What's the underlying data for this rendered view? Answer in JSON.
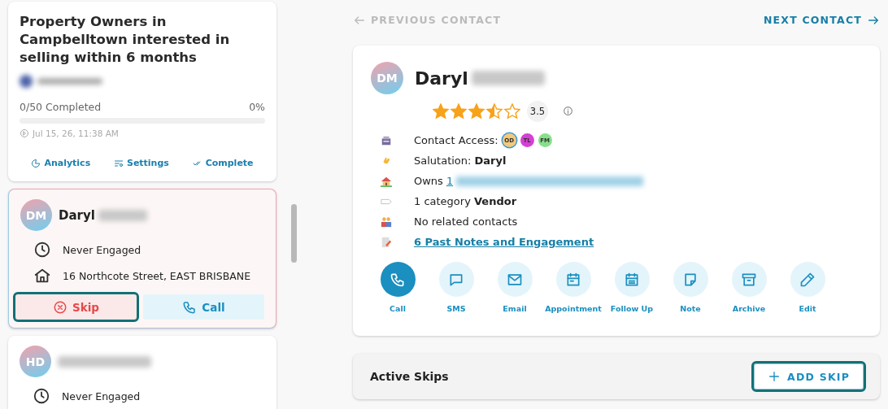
{
  "campaign": {
    "title": "Property Owners in Campbelltown interested in selling within 6 months",
    "progress_text": "0/50 Completed",
    "percent": "0%",
    "level": 0,
    "date": "Jul 15, 26, 11:38 AM",
    "actions": [
      {
        "kind": "analytics",
        "label": "Analytics"
      },
      {
        "kind": "settings",
        "label": "Settings"
      },
      {
        "kind": "complete",
        "label": "Complete"
      }
    ]
  },
  "contact_list": [
    {
      "initials": "DM",
      "name": "Daryl",
      "selected": true,
      "rows": [
        {
          "kind": "clock",
          "text": "Never Engaged"
        },
        {
          "kind": "home",
          "text": "16 Northcote Street, EAST BRISBANE"
        }
      ],
      "buttons": [
        {
          "kind": "skip",
          "label": "Skip",
          "highlighted": true
        },
        {
          "kind": "call",
          "label": "Call",
          "highlighted": false
        }
      ]
    },
    {
      "initials": "HD",
      "selected": false,
      "rows": [
        {
          "kind": "clock",
          "text": "Never Engaged"
        }
      ]
    }
  ],
  "nav": {
    "previous": "PREVIOUS CONTACT",
    "previous_disabled": true,
    "next": "NEXT CONTACT",
    "next_disabled": false
  },
  "contact": {
    "initials": "DM",
    "first_name": "Daryl",
    "stars": 3.5,
    "rating": "3.5",
    "details": [
      {
        "kind": "access",
        "text": "Contact Access:",
        "badges": [
          {
            "initials": "OD",
            "color": "#f3c97b"
          },
          {
            "initials": "TL",
            "color": "#d63fd6"
          },
          {
            "initials": "FM",
            "color": "#86e08a"
          }
        ]
      },
      {
        "kind": "wave",
        "text": "Salutation: **Daryl**"
      },
      {
        "kind": "house",
        "text": "Owns",
        "link": "1"
      },
      {
        "kind": "tag",
        "text": "1 category **Vendor**"
      },
      {
        "kind": "people",
        "text": "No related contacts"
      },
      {
        "kind": "note",
        "link": "6 Past Notes and Engagement"
      }
    ],
    "actions": [
      {
        "kind": "call",
        "label": "Call",
        "selected": true
      },
      {
        "kind": "sms",
        "label": "SMS",
        "selected": false
      },
      {
        "kind": "email",
        "label": "Email",
        "selected": false
      },
      {
        "kind": "appointment",
        "label": "Appointment",
        "selected": false
      },
      {
        "kind": "followup",
        "label": "Follow Up",
        "selected": false
      },
      {
        "kind": "note",
        "label": "Note",
        "selected": false
      },
      {
        "kind": "archive",
        "label": "Archive",
        "selected": false
      },
      {
        "kind": "edit",
        "label": "Edit",
        "selected": false
      }
    ]
  },
  "skips": {
    "title": "Active Skips",
    "button": "ADD SKIP",
    "highlighted": true
  }
}
